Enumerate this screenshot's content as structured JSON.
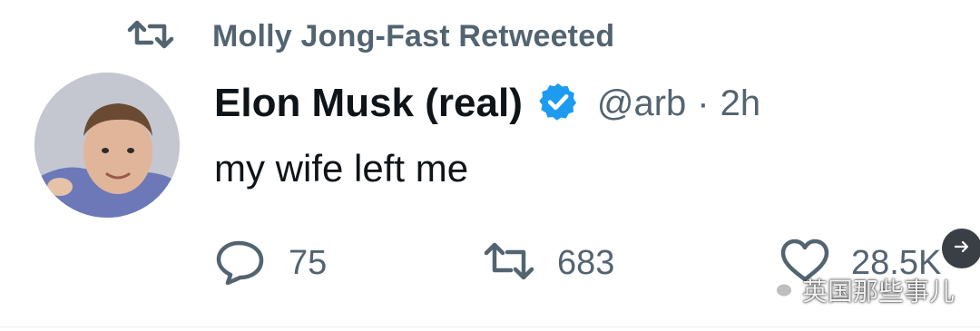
{
  "retweet_banner": {
    "icon": "retweet-icon",
    "text": "Molly Jong-Fast Retweeted"
  },
  "tweet": {
    "avatar": "profile-photo",
    "display_name": "Elon Musk (real)",
    "verified_icon": "verified-badge-icon",
    "handle": "@arb",
    "separator": "·",
    "time": "2h",
    "text": "my wife left me"
  },
  "actions": {
    "reply": {
      "icon": "reply-icon",
      "count": "75"
    },
    "retweet": {
      "icon": "retweet-icon",
      "count": "683"
    },
    "like": {
      "icon": "heart-icon",
      "count": "28.5K"
    }
  },
  "overlay": {
    "next_icon": "arrow-right-icon",
    "watermark_text": "英国那些事儿"
  },
  "colors": {
    "text": "#0f1419",
    "muted": "#536471",
    "verified": "#1d9bf0"
  }
}
